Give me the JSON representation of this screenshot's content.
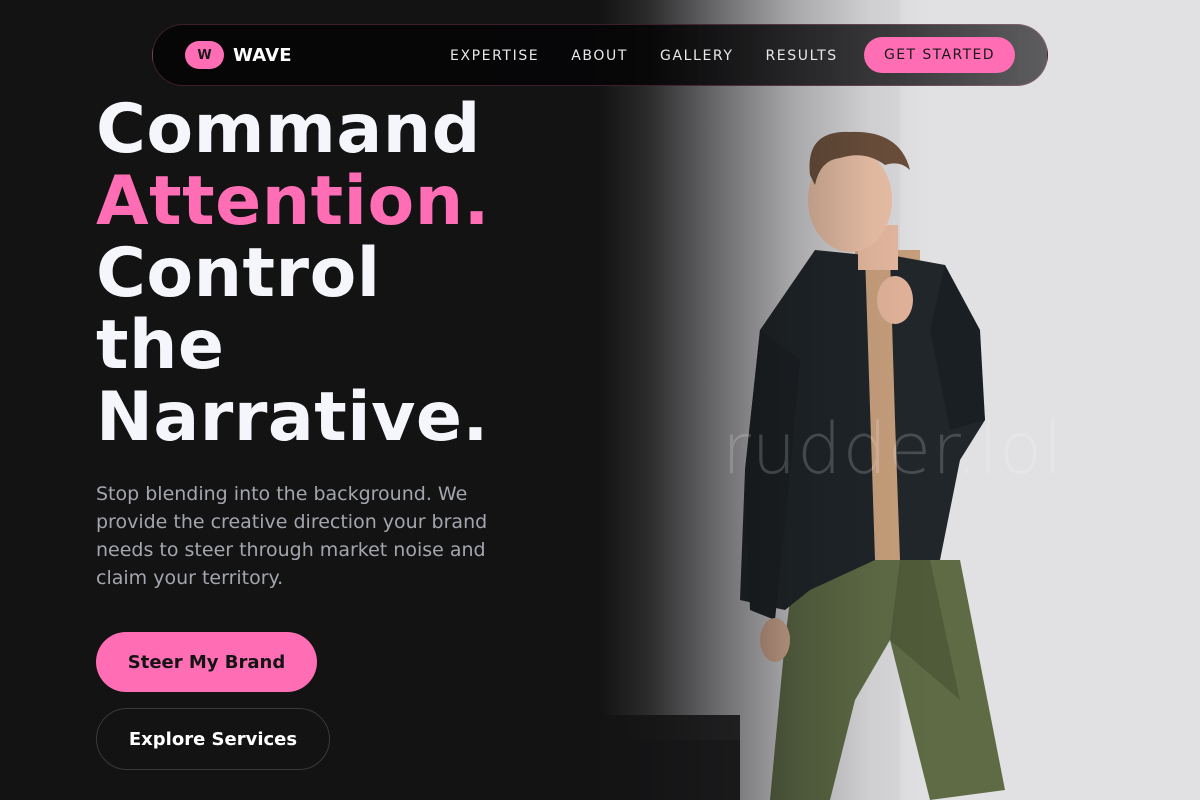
{
  "brand": {
    "mark": "W",
    "name": "WAVE"
  },
  "nav": {
    "links": [
      {
        "label": "EXPERTISE"
      },
      {
        "label": "ABOUT"
      },
      {
        "label": "GALLERY"
      },
      {
        "label": "RESULTS"
      }
    ],
    "cta_label": "GET STARTED"
  },
  "hero": {
    "headline_lines": [
      "Command",
      "Attention.",
      "Control",
      "the",
      "Narrative."
    ],
    "subtext": "Stop blending into the background. We provide the creative direction your brand needs to steer through market noise and claim your territory.",
    "primary_button": "Steer My Brand",
    "secondary_button": "Explore Services",
    "watermark": "rudder.lol"
  },
  "colors": {
    "background": "#131314",
    "accent": "#ff6eb4",
    "headline": "#f4f6fb",
    "body_text": "#a3a6ad"
  }
}
